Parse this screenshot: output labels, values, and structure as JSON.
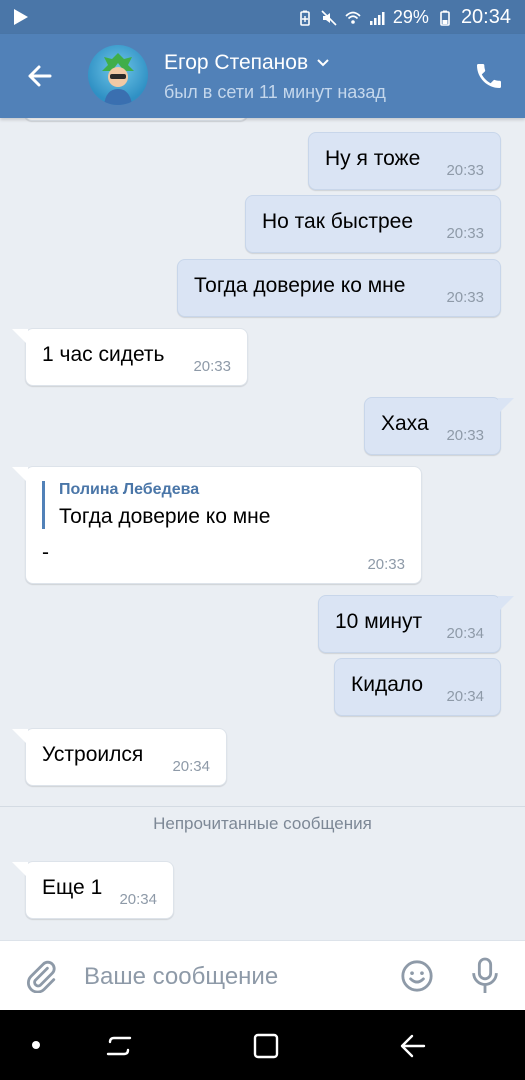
{
  "status_bar": {
    "battery": "29%",
    "time": "20:34"
  },
  "header": {
    "contact_name": "Егор Степанов",
    "contact_status": "был в сети 11 минут назад"
  },
  "messages": [
    {
      "dir": "out",
      "text": "Ну я тоже",
      "time": "20:33"
    },
    {
      "dir": "out",
      "text": "Но так быстрее",
      "time": "20:33"
    },
    {
      "dir": "out",
      "text": "Тогда доверие ко мне",
      "time": "20:33"
    },
    {
      "dir": "in",
      "text": "1 час сидеть",
      "time": "20:33"
    },
    {
      "dir": "out",
      "text": "Хаха",
      "time": "20:33"
    },
    {
      "dir": "in",
      "quote_author": "Полина Лебедева",
      "quote_text": "Тогда доверие ко мне",
      "text": "-",
      "time": "20:33"
    },
    {
      "dir": "out",
      "text": "10 минут",
      "time": "20:34"
    },
    {
      "dir": "out",
      "text": "Кидало",
      "time": "20:34"
    },
    {
      "dir": "in",
      "text": "Устроился",
      "time": "20:34"
    },
    {
      "dir": "in",
      "text": "Еще 1",
      "time": "20:34"
    }
  ],
  "unread_divider": "Непрочитанные сообщения",
  "composer": {
    "placeholder": "Ваше сообщение"
  },
  "colors": {
    "header": "#5181b8",
    "status_bar": "#4a76a8",
    "outgoing_bubble": "#dae4f4",
    "incoming_bubble": "#ffffff",
    "background": "#eaeef3"
  }
}
